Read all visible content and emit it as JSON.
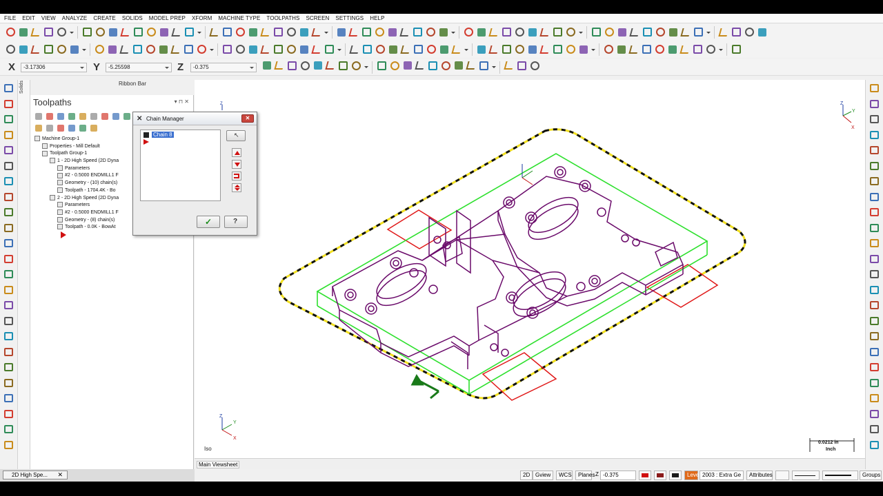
{
  "menu": [
    "FILE",
    "EDIT",
    "VIEW",
    "ANALYZE",
    "CREATE",
    "SOLIDS",
    "MODEL PREP",
    "XFORM",
    "MACHINE TYPE",
    "TOOLPATHS",
    "SCREEN",
    "SETTINGS",
    "HELP"
  ],
  "coords": {
    "x_label": "X",
    "x_value": "-3.17306",
    "y_label": "Y",
    "y_value": "-5.25598",
    "z_label": "Z",
    "z_value": "-0.375"
  },
  "ribbon_label": "Ribbon Bar",
  "solids_tab": "Solids",
  "panel": {
    "title": "Toolpaths",
    "controls": "▾ ⊓ ✕",
    "tree": [
      {
        "text": "Machine Group-1",
        "indent": 0
      },
      {
        "text": "Properties - Mill Default",
        "indent": 1
      },
      {
        "text": "Toolpath Group-1",
        "indent": 1
      },
      {
        "text": "1 - 2D High Speed (2D Dyna",
        "indent": 2
      },
      {
        "text": "Parameters",
        "indent": 3
      },
      {
        "text": "#2 - 0.5000 ENDMILL1 F",
        "indent": 3
      },
      {
        "text": "Geometry - (10) chain(s)",
        "indent": 3
      },
      {
        "text": "Toolpath - 1704.4K - Bo",
        "indent": 3
      },
      {
        "text": "2 - 2D High Speed (2D Dyna",
        "indent": 2
      },
      {
        "text": "Parameters",
        "indent": 3
      },
      {
        "text": "#2 - 0.5000 ENDMILL1 F",
        "indent": 3
      },
      {
        "text": "Geometry - (8) chain(s)",
        "indent": 3
      },
      {
        "text": "Toolpath - 0.0K - BowAt",
        "indent": 3
      }
    ]
  },
  "dialog": {
    "title": "Chain Manager",
    "chain_item": "Chain 8"
  },
  "viewport": {
    "view_name": "Iso",
    "scale_value": "0.0212 in",
    "scale_unit": "Inch",
    "sheet_tab": "Main Viewsheet",
    "axis_z": "Z",
    "axis_y": "Y",
    "axis_x": "X"
  },
  "bottom_tab": {
    "label": "2D High Spe...",
    "close": "✕"
  },
  "status": {
    "mode_2d": "2D",
    "gview": "Gview",
    "wcs": "WCS",
    "planes": "Planes",
    "z_label": "Z",
    "z_value": "-0.375",
    "level_label": "Level",
    "level_value": "2003 : Extra Ge",
    "attributes": "Attributes",
    "groups": "Groups"
  },
  "colors": {
    "part": "#6a0a6a",
    "stock": "#2ee02e",
    "boundary": "#e01818",
    "containment": "#f2e020",
    "accent": "#3a6fcf"
  }
}
